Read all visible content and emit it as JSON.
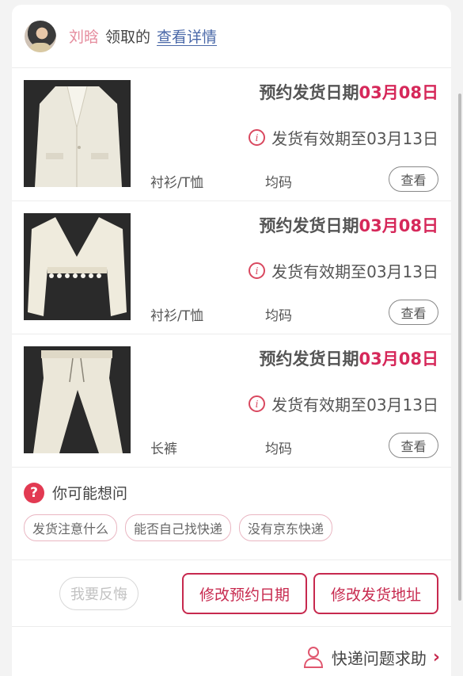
{
  "header": {
    "user_name": "刘晗",
    "claim_text": "领取的",
    "detail_link": "查看详情"
  },
  "items": [
    {
      "ship_label": "预约发货日期",
      "ship_date": "03月08日",
      "validity": "发货有效期至03月13日",
      "category": "衬衫/T恤",
      "size": "均码",
      "view_label": "查看",
      "image_icon": "blazer-image"
    },
    {
      "ship_label": "预约发货日期",
      "ship_date": "03月08日",
      "validity": "发货有效期至03月13日",
      "category": "衬衫/T恤",
      "size": "均码",
      "view_label": "查看",
      "image_icon": "cardigan-image"
    },
    {
      "ship_label": "预约发货日期",
      "ship_date": "03月08日",
      "validity": "发货有效期至03月13日",
      "category": "长裤",
      "size": "均码",
      "view_label": "查看",
      "image_icon": "trousers-image"
    }
  ],
  "faq": {
    "title": "你可能想问",
    "chips": [
      "发货注意什么",
      "能否自己找快递",
      "没有京东快递"
    ]
  },
  "actions": {
    "regret": "我要反悔",
    "change_date": "修改预约日期",
    "change_address": "修改发货地址"
  },
  "help": {
    "label": "快递问题求助"
  },
  "colors": {
    "accent": "#c7294e",
    "date_red": "#d6285a",
    "user_pink": "#e58c9d",
    "link_blue": "#4a68a8"
  }
}
